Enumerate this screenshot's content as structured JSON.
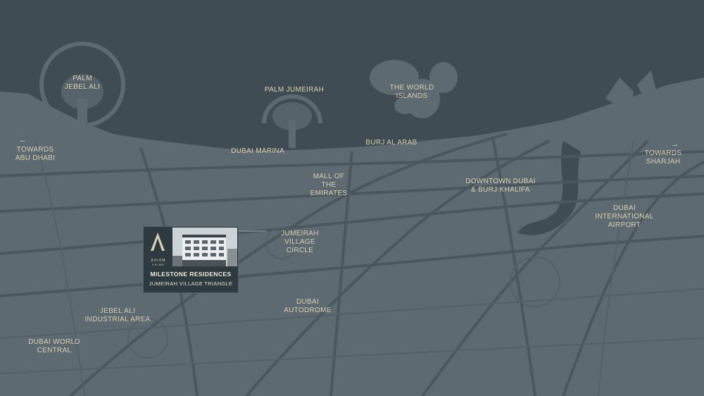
{
  "map": {
    "colors": {
      "sea": "#3f4c53",
      "land": "#5d6a71",
      "road": "#4a575e",
      "label": "#d9cfad"
    },
    "labels": {
      "palm_jebel_ali": [
        "PALM",
        "JEBEL ALI"
      ],
      "palm_jumeirah": [
        "PALM JUMEIRAH"
      ],
      "world_islands": [
        "THE WORLD",
        "ISLANDS"
      ],
      "towards_abu_dhabi": [
        "TOWARDS",
        "ABU DHABI"
      ],
      "dubai_marina": [
        "DUBAI MARINA"
      ],
      "burj_al_arab": [
        "BURJ AL ARAB"
      ],
      "towards_sharjah": [
        "TOWARDS",
        "SHARJAH"
      ],
      "mall_of_emirates": [
        "MALL OF",
        "THE",
        "EMIRATES"
      ],
      "downtown": [
        "DOWNTOWN DUBAI",
        "& BURJ KHALIFA"
      ],
      "airport": [
        "DUBAI",
        "INTERNATIONAL",
        "AIRPORT"
      ],
      "jvc": [
        "JUMEIRAH",
        "VILLAGE",
        "CIRCLE"
      ],
      "autodrome": [
        "DUBAI",
        "AUTODROME"
      ],
      "jebel_ali_industrial": [
        "JEBEL ALI",
        "INDUSTRIAL AREA"
      ],
      "dubai_world_central": [
        "DUBAI WORLD",
        "CENTRAL"
      ]
    },
    "arrow_left": "←",
    "arrow_right": "→"
  },
  "project_card": {
    "brand": "AXIOM",
    "brand_sub": "PRIME",
    "title": "MILESTONE RESIDENCES",
    "subtitle": "JUMEIRAH VILLAGE TRIANGLE"
  }
}
